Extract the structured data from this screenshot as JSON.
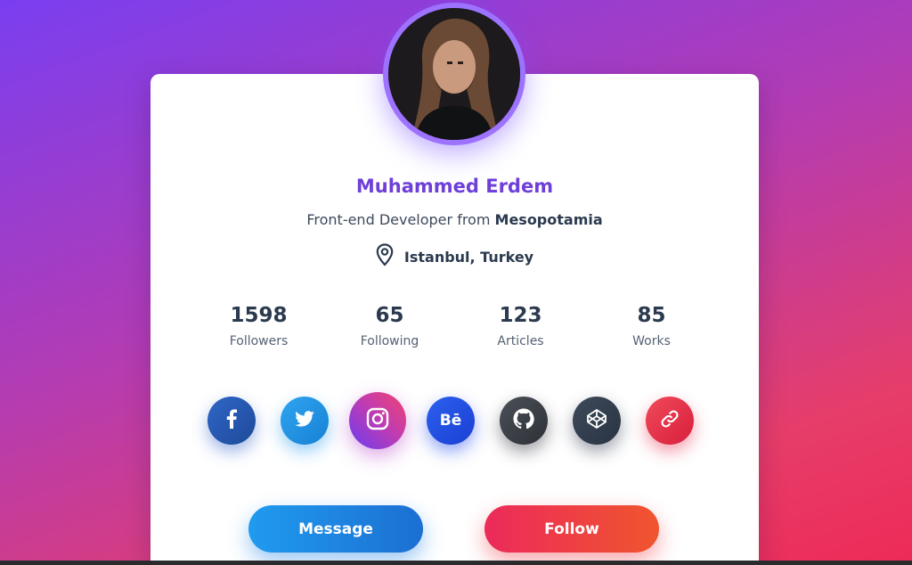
{
  "profile": {
    "name": "Muhammed Erdem",
    "bio_prefix": "Front-end Developer from ",
    "bio_place": "Mesopotamia",
    "location": "Istanbul, Turkey"
  },
  "stats": [
    {
      "value": "1598",
      "label": "Followers"
    },
    {
      "value": "65",
      "label": "Following"
    },
    {
      "value": "123",
      "label": "Articles"
    },
    {
      "value": "85",
      "label": "Works"
    }
  ],
  "socials": [
    {
      "icon": "facebook-icon",
      "color": "#2f66c8"
    },
    {
      "icon": "twitter-icon",
      "color": "#2fa4f0"
    },
    {
      "icon": "instagram-icon",
      "color": "#c23cb0"
    },
    {
      "icon": "behance-icon",
      "color": "#2d60f0",
      "text": "Bē"
    },
    {
      "icon": "github-icon",
      "color": "#3a3e45"
    },
    {
      "icon": "codepen-icon",
      "color": "#334050"
    },
    {
      "icon": "link-icon",
      "color": "#e43048"
    }
  ],
  "actions": {
    "message_label": "Message",
    "follow_label": "Follow"
  },
  "colors": {
    "accent": "#6e3fd9",
    "text": "#2b3a4f"
  }
}
